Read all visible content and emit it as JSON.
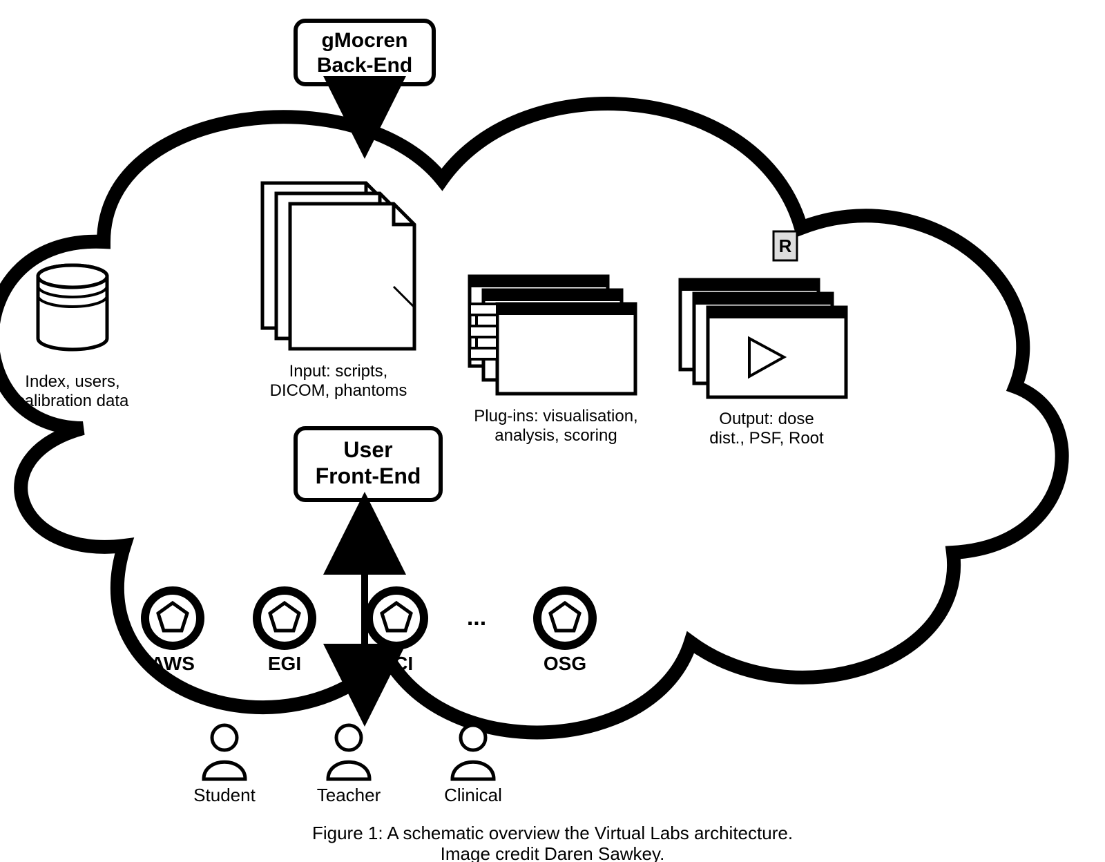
{
  "diagram": {
    "title_line1": "Figure 1: A schematic overview the Virtual Labs architecture.",
    "title_line2": "Image credit Daren Sawkey.",
    "backend_box": "gMocren\nBack-End",
    "frontend_box": "User\nFront-End",
    "datastore_caption": "Index, users, calibration data",
    "input_caption": "Input: scripts, DICOM, phantoms",
    "plugins_caption": "Plug-ins: visualisation, analysis, scoring",
    "output_caption": "Output: dose dist., PSF, Root",
    "roles": [
      "Student",
      "Teacher",
      "Clinical"
    ],
    "services": [
      "AWS",
      "EGI",
      "NCI",
      "OSG"
    ],
    "services_label": "...",
    "output_badge": "R",
    "icons": {
      "database": "database-icon",
      "cloud": "cloud-icon",
      "documents": "documents-icon",
      "plugins": "plugins-icon",
      "output_windows": "output-windows-icon",
      "user": "user-icon",
      "service_node": "service-node-icon"
    }
  }
}
